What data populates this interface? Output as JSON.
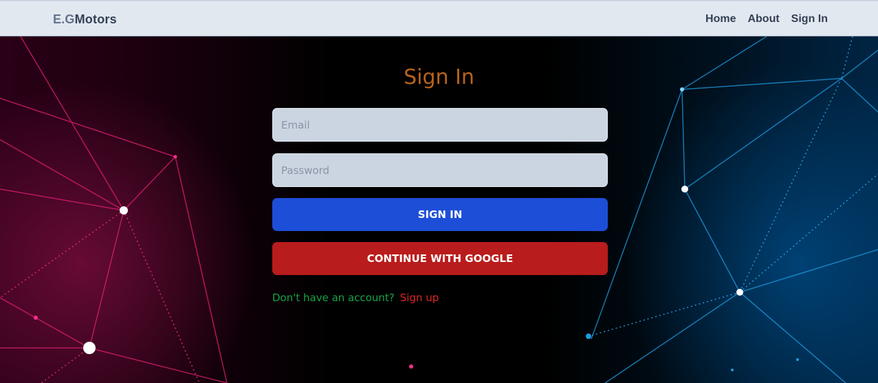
{
  "navbar": {
    "logo_part1": "E.G",
    "logo_part2": "Motors",
    "links": [
      {
        "label": "Home"
      },
      {
        "label": "About"
      },
      {
        "label": "Sign In"
      }
    ]
  },
  "form": {
    "title": "Sign In",
    "email_placeholder": "Email",
    "email_value": "",
    "password_placeholder": "Password",
    "password_value": "",
    "signin_button": "SIGN IN",
    "google_button": "CONTINUE WITH GOOGLE",
    "no_account_text": "Don't have an account?",
    "signup_link": "Sign up"
  },
  "colors": {
    "title": "#b8621b",
    "signin_button": "#1d4ed8",
    "google_button": "#b91c1c",
    "question_text": "#16a34a",
    "signup_link": "#dc2626"
  }
}
